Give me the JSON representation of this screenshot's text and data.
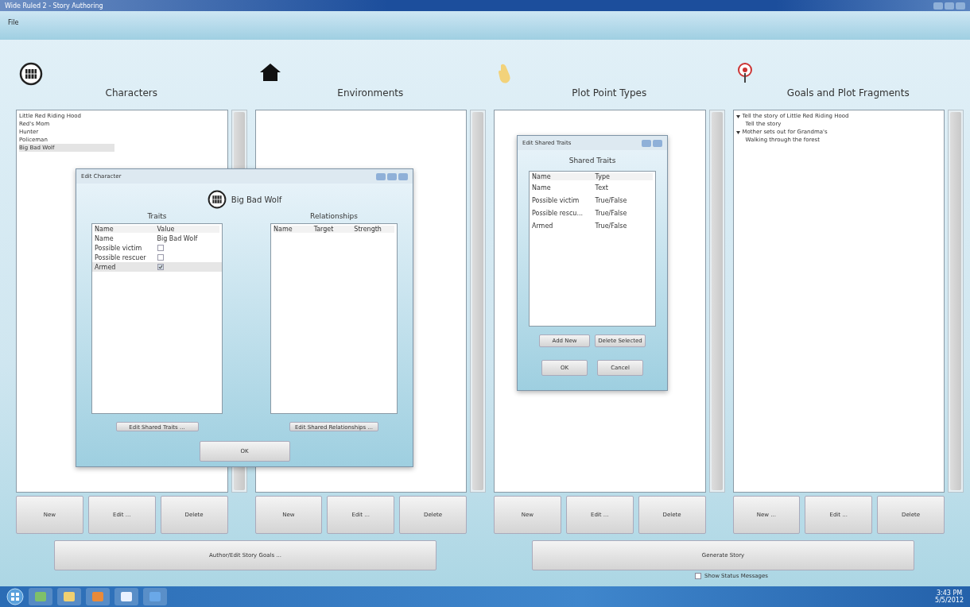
{
  "window": {
    "title": "Wide Ruled 2 - Story Authoring",
    "menu": [
      "File"
    ]
  },
  "panels": [
    {
      "title": "Characters",
      "items": [
        {
          "label": "Little Red Riding Hood",
          "selected": false
        },
        {
          "label": "Red's Mom",
          "selected": false
        },
        {
          "label": "Hunter",
          "selected": false
        },
        {
          "label": "Policeman",
          "selected": false
        },
        {
          "label": "Big Bad Wolf",
          "selected": true
        }
      ],
      "buttons": [
        "New",
        "Edit ...",
        "Delete"
      ]
    },
    {
      "title": "Environments",
      "buttons": [
        "New",
        "Edit ...",
        "Delete"
      ]
    },
    {
      "title": "Plot Point Types",
      "buttons": [
        "New",
        "Edit ...",
        "Delete"
      ]
    },
    {
      "title": "Goals and Plot Fragments",
      "tree": [
        {
          "label": "Tell the story of Little Red Riding Hood",
          "expanded": true,
          "children": [
            {
              "label": "Tell the story"
            }
          ]
        },
        {
          "label": "Mother sets out for Grandma's",
          "expanded": true,
          "children": [
            {
              "label": "Walking through the forest"
            }
          ]
        }
      ],
      "buttons": [
        "New ...",
        "Edit ...",
        "Delete"
      ]
    }
  ],
  "actions": [
    "Author/Edit Story Goals ...",
    "Generate Story"
  ],
  "status_option": {
    "label": "Show Status Messages",
    "checked": false
  },
  "edit_character": {
    "title": "Edit Character",
    "name": "Big Bad Wolf",
    "traits_title": "Traits",
    "trait_columns": [
      "Name",
      "Value"
    ],
    "traits": [
      {
        "name": "Name",
        "kind": "text",
        "value": "Big Bad Wolf",
        "selected": false
      },
      {
        "name": "Possible victim",
        "kind": "checkbox",
        "checked": false,
        "selected": false
      },
      {
        "name": "Possible rescuer",
        "kind": "checkbox",
        "checked": false,
        "selected": false
      },
      {
        "name": "Armed",
        "kind": "checkbox",
        "checked": true,
        "selected": true
      }
    ],
    "relationships_title": "Relationships",
    "relationship_columns": [
      "Name",
      "Target",
      "Strength"
    ],
    "buttons": [
      "Edit Shared Traits ...",
      "Edit Shared Relationships ..."
    ],
    "ok": "OK"
  },
  "shared_traits": {
    "title": "Edit Shared Traits",
    "heading": "Shared Traits",
    "columns": [
      "Name",
      "Type"
    ],
    "rows": [
      {
        "name": "Name",
        "type": "Text"
      },
      {
        "name": "Possible victim",
        "type": "True/False"
      },
      {
        "name": "Possible rescu...",
        "type": "True/False"
      },
      {
        "name": "Armed",
        "type": "True/False"
      }
    ],
    "buttons": [
      "Add New",
      "Delete Selected"
    ],
    "ok": "OK",
    "cancel": "Cancel"
  },
  "taskbar": {
    "time": "3:43 PM",
    "date": "5/5/2012"
  }
}
